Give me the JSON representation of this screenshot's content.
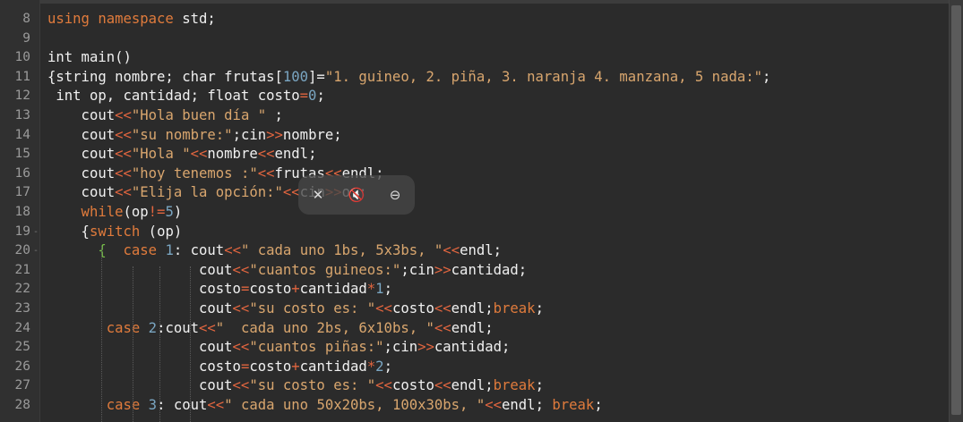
{
  "editor": {
    "lines": [
      {
        "num": "8",
        "fold": "",
        "tokens": [
          [
            "kw",
            "using namespace"
          ],
          [
            "df",
            " std;"
          ]
        ]
      },
      {
        "num": "9",
        "fold": "",
        "tokens": []
      },
      {
        "num": "10",
        "fold": "",
        "tokens": [
          [
            "df",
            "int main()"
          ]
        ]
      },
      {
        "num": "11",
        "fold": "",
        "tokens": [
          [
            "df",
            "{string nombre; char frutas["
          ],
          [
            "nm",
            "100"
          ],
          [
            "df",
            "]="
          ],
          [
            "st",
            "\"1. guineo, 2. piña, 3. naranja 4. manzana, 5 nada:\""
          ],
          [
            "df",
            ";"
          ]
        ]
      },
      {
        "num": "12",
        "fold": "",
        "tokens": [
          [
            "df",
            " int op, cantidad; float costo"
          ],
          [
            "op",
            "="
          ],
          [
            "nm",
            "0"
          ],
          [
            "df",
            ";"
          ]
        ]
      },
      {
        "num": "13",
        "fold": "",
        "tokens": [
          [
            "df",
            "    cout"
          ],
          [
            "op",
            "<<"
          ],
          [
            "st",
            "\"Hola buen día \""
          ],
          [
            "df",
            " ;"
          ]
        ]
      },
      {
        "num": "14",
        "fold": "",
        "tokens": [
          [
            "df",
            "    cout"
          ],
          [
            "op",
            "<<"
          ],
          [
            "st",
            "\"su nombre:\""
          ],
          [
            "df",
            ";cin"
          ],
          [
            "op",
            ">>"
          ],
          [
            "df",
            "nombre;"
          ]
        ]
      },
      {
        "num": "15",
        "fold": "",
        "tokens": [
          [
            "df",
            "    cout"
          ],
          [
            "op",
            "<<"
          ],
          [
            "st",
            "\"Hola \""
          ],
          [
            "op",
            "<<"
          ],
          [
            "df",
            "nombre"
          ],
          [
            "op",
            "<<"
          ],
          [
            "df",
            "endl;"
          ]
        ]
      },
      {
        "num": "16",
        "fold": "",
        "tokens": [
          [
            "df",
            "    cout"
          ],
          [
            "op",
            "<<"
          ],
          [
            "st",
            "\"hoy tenemos :\""
          ],
          [
            "op",
            "<<"
          ],
          [
            "df",
            "frutas"
          ],
          [
            "op",
            "<<"
          ],
          [
            "df",
            "endl;"
          ]
        ]
      },
      {
        "num": "17",
        "fold": "",
        "tokens": [
          [
            "df",
            "    cout"
          ],
          [
            "op",
            "<<"
          ],
          [
            "st",
            "\"Elija la opción:\""
          ],
          [
            "op",
            "<<"
          ],
          [
            "df",
            "cin"
          ],
          [
            "op",
            ">>"
          ],
          [
            "df",
            "op;"
          ]
        ]
      },
      {
        "num": "18",
        "fold": "",
        "tokens": [
          [
            "kw",
            "    while"
          ],
          [
            "df",
            "(op"
          ],
          [
            "op",
            "!="
          ],
          [
            "nm",
            "5"
          ],
          [
            "df",
            ")"
          ]
        ]
      },
      {
        "num": "19",
        "fold": "-",
        "tokens": [
          [
            "df",
            "    {"
          ],
          [
            "kw",
            "switch"
          ],
          [
            "df",
            " (op)"
          ]
        ]
      },
      {
        "num": "20",
        "fold": "-",
        "tokens": [
          [
            "df",
            "      "
          ],
          [
            "br",
            "{"
          ],
          [
            "df",
            "  "
          ],
          [
            "kw",
            "case"
          ],
          [
            "df",
            " "
          ],
          [
            "nm",
            "1"
          ],
          [
            "df",
            ": cout"
          ],
          [
            "op",
            "<<"
          ],
          [
            "st",
            "\" cada uno 1bs, 5x3bs, \""
          ],
          [
            "op",
            "<<"
          ],
          [
            "df",
            "endl;"
          ]
        ]
      },
      {
        "num": "21",
        "fold": "",
        "tokens": [
          [
            "df",
            "                  cout"
          ],
          [
            "op",
            "<<"
          ],
          [
            "st",
            "\"cuantos guineos:\""
          ],
          [
            "df",
            ";cin"
          ],
          [
            "op",
            ">>"
          ],
          [
            "df",
            "cantidad;"
          ]
        ]
      },
      {
        "num": "22",
        "fold": "",
        "tokens": [
          [
            "df",
            "                  costo"
          ],
          [
            "op",
            "="
          ],
          [
            "df",
            "costo"
          ],
          [
            "op",
            "+"
          ],
          [
            "df",
            "cantidad"
          ],
          [
            "op",
            "*"
          ],
          [
            "nm",
            "1"
          ],
          [
            "df",
            ";"
          ]
        ]
      },
      {
        "num": "23",
        "fold": "",
        "tokens": [
          [
            "df",
            "                  cout"
          ],
          [
            "op",
            "<<"
          ],
          [
            "st",
            "\"su costo es: \""
          ],
          [
            "op",
            "<<"
          ],
          [
            "df",
            "costo"
          ],
          [
            "op",
            "<<"
          ],
          [
            "df",
            "endl;"
          ],
          [
            "kw",
            "break"
          ],
          [
            "df",
            ";"
          ]
        ]
      },
      {
        "num": "24",
        "fold": "",
        "tokens": [
          [
            "kw",
            "       case"
          ],
          [
            "df",
            " "
          ],
          [
            "nm",
            "2"
          ],
          [
            "df",
            ":cout"
          ],
          [
            "op",
            "<<"
          ],
          [
            "st",
            "\"  cada uno 2bs, 6x10bs, \""
          ],
          [
            "op",
            "<<"
          ],
          [
            "df",
            "endl;"
          ]
        ]
      },
      {
        "num": "25",
        "fold": "",
        "tokens": [
          [
            "df",
            "                  cout"
          ],
          [
            "op",
            "<<"
          ],
          [
            "st",
            "\"cuantos piñas:\""
          ],
          [
            "df",
            ";cin"
          ],
          [
            "op",
            ">>"
          ],
          [
            "df",
            "cantidad;"
          ]
        ]
      },
      {
        "num": "26",
        "fold": "",
        "tokens": [
          [
            "df",
            "                  costo"
          ],
          [
            "op",
            "="
          ],
          [
            "df",
            "costo"
          ],
          [
            "op",
            "+"
          ],
          [
            "df",
            "cantidad"
          ],
          [
            "op",
            "*"
          ],
          [
            "nm",
            "2"
          ],
          [
            "df",
            ";"
          ]
        ]
      },
      {
        "num": "27",
        "fold": "",
        "tokens": [
          [
            "df",
            "                  cout"
          ],
          [
            "op",
            "<<"
          ],
          [
            "st",
            "\"su costo es: \""
          ],
          [
            "op",
            "<<"
          ],
          [
            "df",
            "costo"
          ],
          [
            "op",
            "<<"
          ],
          [
            "df",
            "endl;"
          ],
          [
            "kw",
            "break"
          ],
          [
            "df",
            ";"
          ]
        ]
      },
      {
        "num": "28",
        "fold": "",
        "tokens": [
          [
            "kw",
            "       case"
          ],
          [
            "df",
            " "
          ],
          [
            "nm",
            "3"
          ],
          [
            "df",
            ": cout"
          ],
          [
            "op",
            "<<"
          ],
          [
            "st",
            "\" cada uno 50x20bs, 100x30bs, \""
          ],
          [
            "op",
            "<<"
          ],
          [
            "df",
            "endl; "
          ],
          [
            "kw",
            "break"
          ],
          [
            "df",
            ";"
          ]
        ]
      }
    ]
  },
  "overlay": {
    "icons": [
      "cursor-off-icon",
      "speaker-muted-icon",
      "zoom-out-icon"
    ]
  },
  "colors": {
    "background": "#2b2b2b",
    "keyword": "#e07b3c",
    "string": "#d9a66e",
    "number": "#7aa6c2",
    "operator": "#e0653f",
    "text": "#f0f0f0",
    "bracket": "#78c24a",
    "line_number": "#9a9a9a"
  }
}
